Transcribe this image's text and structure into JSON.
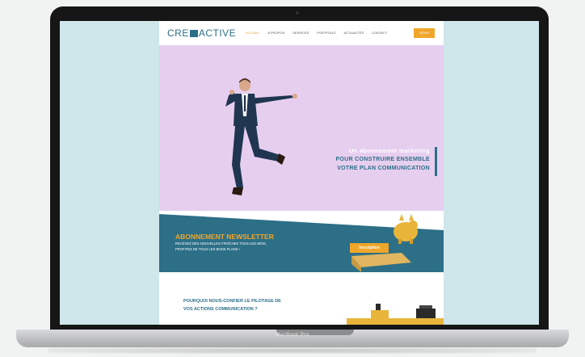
{
  "device": {
    "label": "MacBook Pro"
  },
  "site": {
    "logo": {
      "left": "CRE",
      "right": "ACTIVE"
    },
    "nav": {
      "items": [
        "ACCUEIL",
        "À PROPOS",
        "SERVICES",
        "PORTFOLIO",
        "ACTUALITÉS",
        "CONTACT"
      ],
      "active_index": 0,
      "button_label": "DEVIS"
    },
    "hero": {
      "line1": "Un abonnement marketing",
      "line2": "POUR CONSTRUIRE ENSEMBLE",
      "line3": "VOTRE PLAN COMMUNICATION"
    },
    "newsletter": {
      "title": "ABONNEMENT NEWSLETTER",
      "text1": "RECEVEZ DES NOUVELLES FRAÎCHES TOUS LES MOIS,",
      "text2": "PROFITEZ DE TOUS LES BONS PLANS !",
      "button_label": "Inscription"
    },
    "section2": {
      "line1": "POURQUOI NOUS-CONFIER LE PILOTAGE DE",
      "line2": "VOS ACTIONS COMMUNICATION ?"
    },
    "colors": {
      "brand_teal": "#2c6f87",
      "accent_orange": "#f0a62a",
      "hero_bg": "#e6ceef"
    }
  }
}
